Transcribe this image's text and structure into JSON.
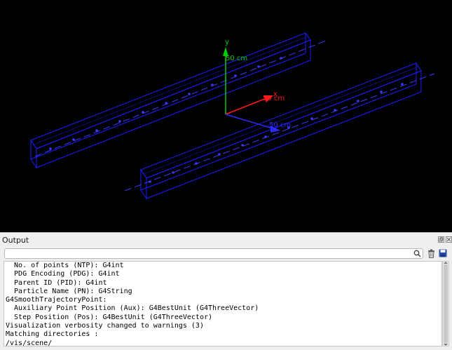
{
  "viewer": {
    "background": "#000000",
    "detector_color": "#1c1cff",
    "trajectory_color": "#3a3aff",
    "axes": {
      "y": {
        "name": "y",
        "label": "50 cm",
        "color": "#00cc00"
      },
      "x": {
        "name": "x",
        "label": "50 cm",
        "color": "#ff1a1a"
      },
      "z": {
        "name": "z",
        "label": "50 cm",
        "color": "#2b2bff"
      }
    }
  },
  "output_panel": {
    "title": "Output",
    "search": {
      "value": "",
      "placeholder": ""
    },
    "icons": {
      "float": "float-window-icon",
      "close": "close-icon",
      "search": "search-icon",
      "clear": "trash-icon",
      "save": "save-icon"
    },
    "log_lines": [
      "  No. of points (NTP): G4int",
      "  PDG Encoding (PDG): G4int",
      "  Parent ID (PID): G4int",
      "  Particle Name (PN): G4String",
      "G4SmoothTrajectoryPoint:",
      "  Auxiliary Point Position (Aux): G4BestUnit (G4ThreeVector)",
      "  Step Position (Pos): G4BestUnit (G4ThreeVector)",
      "Visualization verbosity changed to warnings (3)",
      "Matching directories :",
      "/vis/scene/"
    ]
  }
}
